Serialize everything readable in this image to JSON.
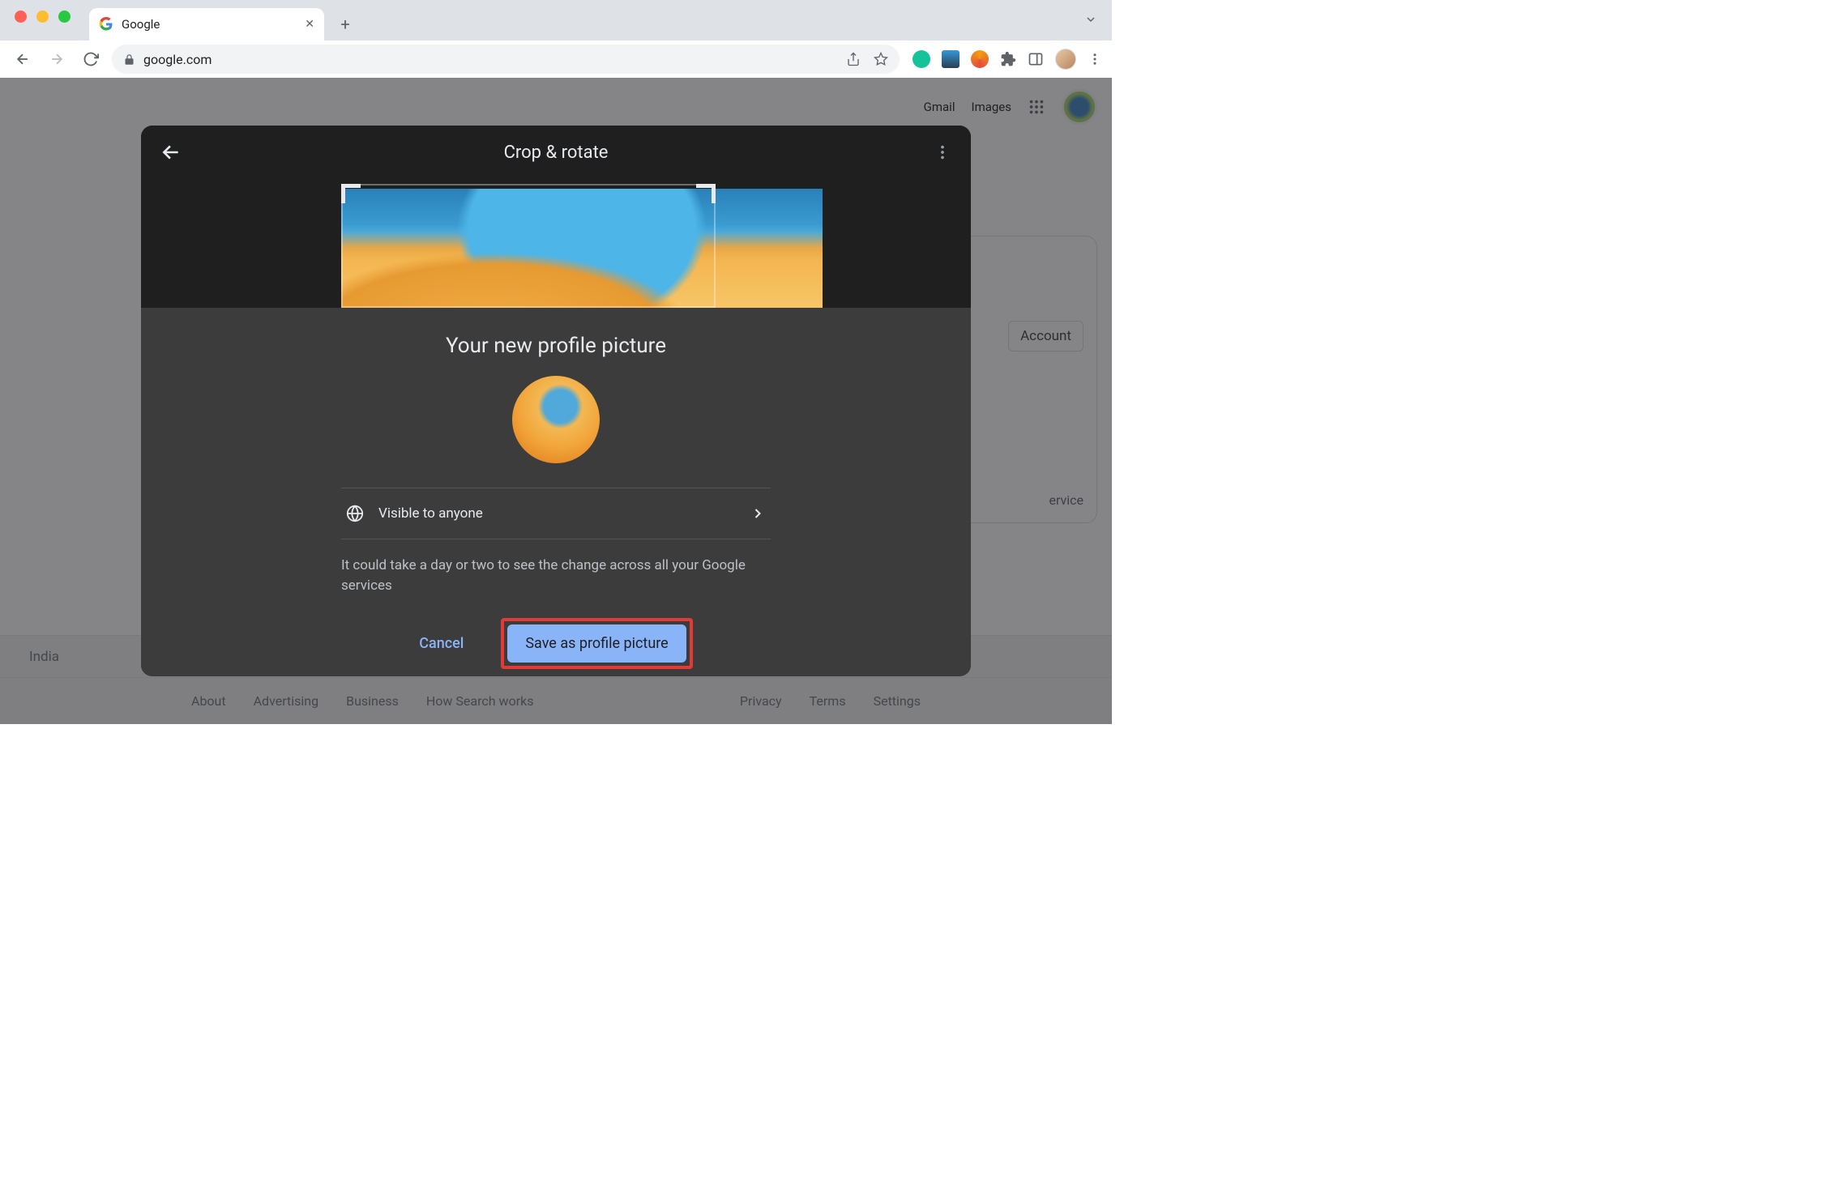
{
  "browser": {
    "tab_title": "Google",
    "url": "google.com",
    "new_tab_icon": "+"
  },
  "google_page": {
    "top_nav": {
      "gmail": "Gmail",
      "images": "Images"
    },
    "side_card": {
      "account_button": "Account",
      "service_text": "ervice"
    },
    "region": "India",
    "footer": {
      "about": "About",
      "advertising": "Advertising",
      "business": "Business",
      "how_works": "How Search works",
      "privacy": "Privacy",
      "terms": "Terms",
      "settings": "Settings"
    }
  },
  "crop_modal": {
    "title": "Crop & rotate"
  },
  "confirm_sheet": {
    "title": "Your new profile picture",
    "visibility_label": "Visible to anyone",
    "notice": "It could take a day or two to see the change across all your Google services",
    "cancel": "Cancel",
    "save": "Save as profile picture"
  }
}
